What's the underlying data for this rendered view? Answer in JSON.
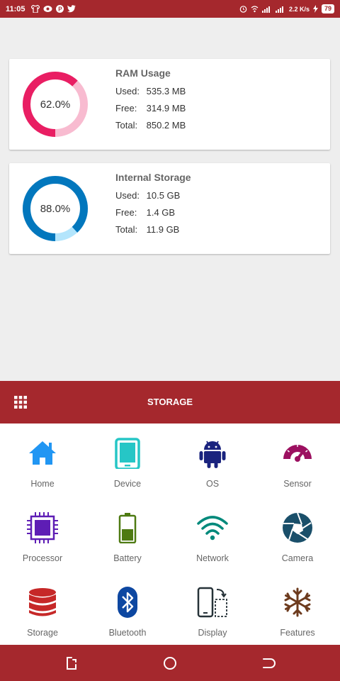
{
  "status_bar": {
    "time": "11:05",
    "network_speed": "2.2 K/s",
    "battery": "79"
  },
  "ram": {
    "title": "RAM Usage",
    "percent_label": "62.0%",
    "percent": 62.0,
    "used_key": "Used:",
    "used": "535.3 MB",
    "free_key": "Free:",
    "free": "314.9 MB",
    "total_key": "Total:",
    "total": "850.2 MB",
    "color_used": "#e91e63",
    "color_free": "#f8bbd0"
  },
  "storage": {
    "title": "Internal Storage",
    "percent_label": "88.0%",
    "percent": 88.0,
    "used_key": "Used:",
    "used": "10.5 GB",
    "free_key": "Free:",
    "free": "1.4 GB",
    "total_key": "Total:",
    "total": "11.9 GB",
    "color_used": "#0277bd",
    "color_free": "#b3e5fc"
  },
  "section": {
    "title": "STORAGE"
  },
  "menu": {
    "items": [
      {
        "label": "Home",
        "icon": "home-icon",
        "color": "#2196f3"
      },
      {
        "label": "Device",
        "icon": "tablet-icon",
        "color": "#26c6c6"
      },
      {
        "label": "OS",
        "icon": "android-icon",
        "color": "#1a237e"
      },
      {
        "label": "Sensor",
        "icon": "gauge-icon",
        "color": "#9c1060"
      },
      {
        "label": "Processor",
        "icon": "chip-icon",
        "color": "#5e1db5"
      },
      {
        "label": "Battery",
        "icon": "battery-icon",
        "color": "#4e7a12"
      },
      {
        "label": "Network",
        "icon": "wifi-icon",
        "color": "#00897b"
      },
      {
        "label": "Camera",
        "icon": "aperture-icon",
        "color": "#1a4f6a"
      },
      {
        "label": "Storage",
        "icon": "database-icon",
        "color": "#c62828"
      },
      {
        "label": "Bluetooth",
        "icon": "bluetooth-icon",
        "color": "#0d47a1"
      },
      {
        "label": "Display",
        "icon": "rotate-screen-icon",
        "color": "#263238"
      },
      {
        "label": "Features",
        "icon": "snowflake-icon",
        "color": "#6d3b1e"
      }
    ]
  },
  "colors": {
    "brand": "#a5282d",
    "background": "#eeeeee"
  }
}
